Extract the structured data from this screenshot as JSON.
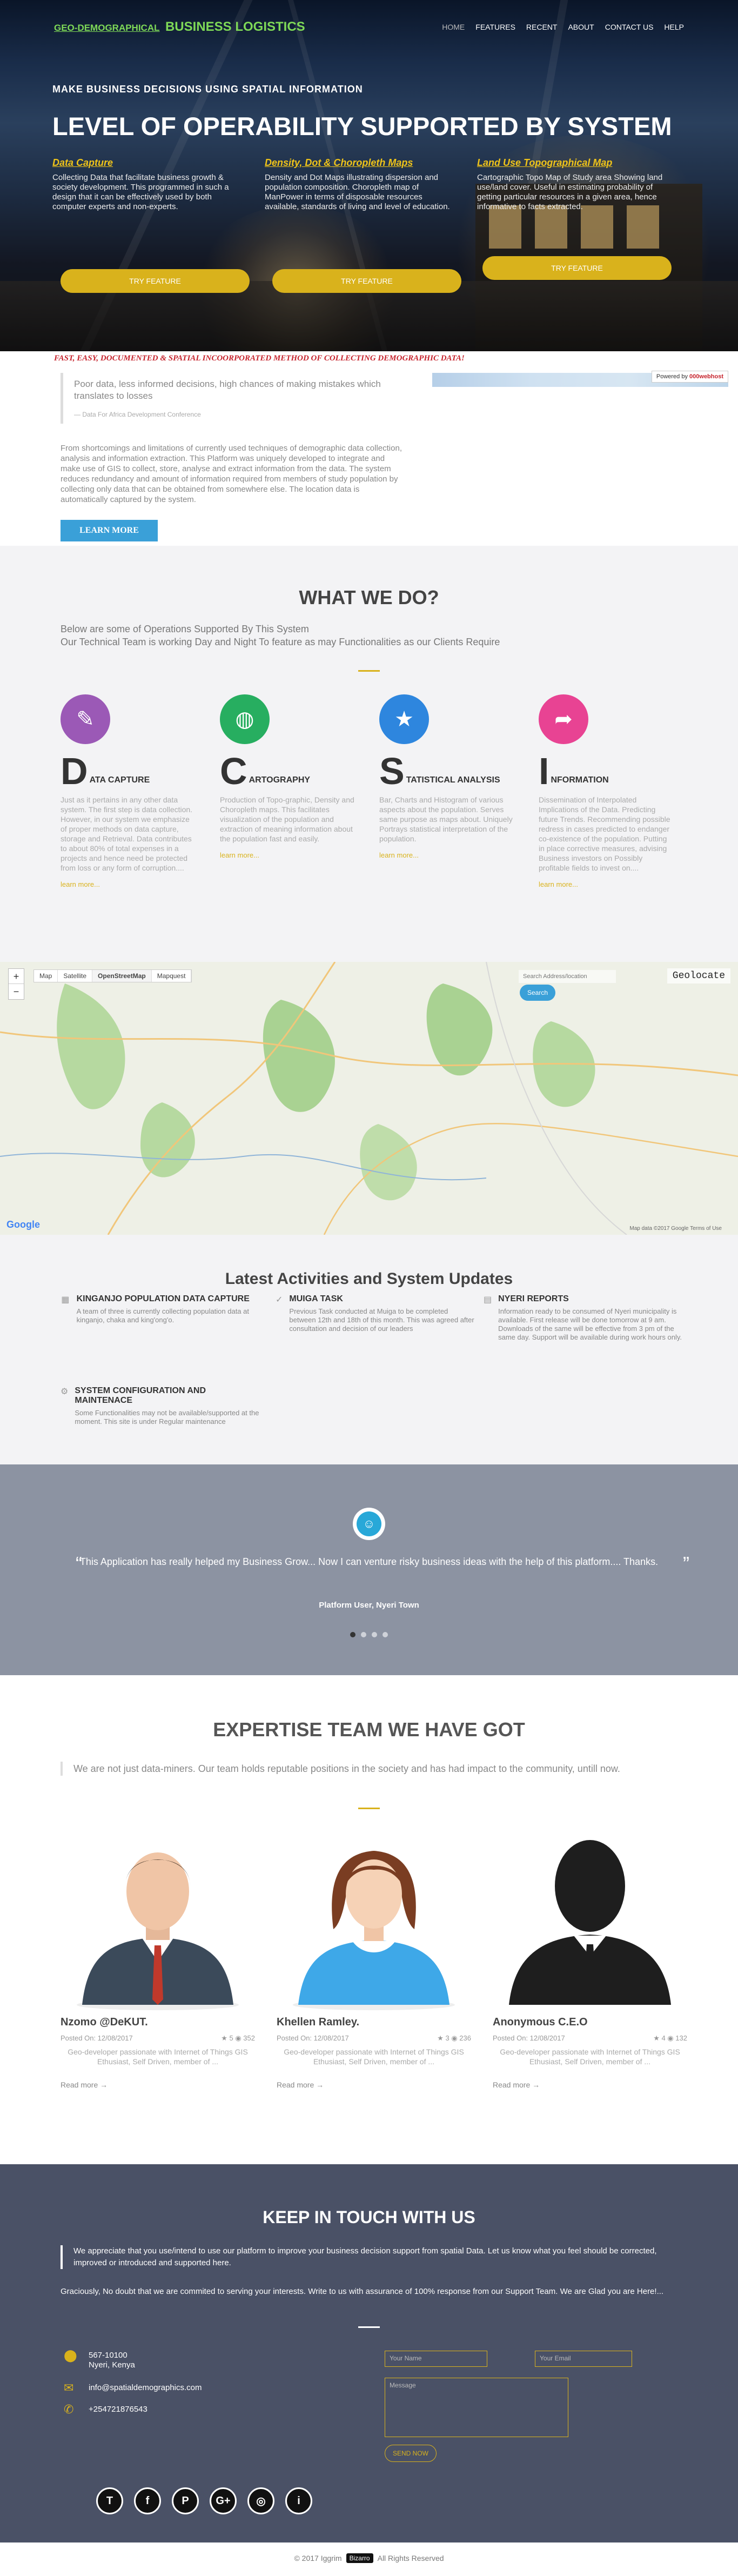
{
  "brand": {
    "geo": "GEO-DEMOGRAPHICAL",
    "logistics": "BUSINESS LOGISTICS"
  },
  "nav": [
    "HOME",
    "FEATURES",
    "RECENT",
    "ABOUT",
    "CONTACT US",
    "HELP"
  ],
  "hero": {
    "kicker": "MAKE BUSINESS DECISIONS USING SPATIAL INFORMATION",
    "title": "LEVEL OF OPERABILITY SUPPORTED BY SYSTEM",
    "features": [
      {
        "title": "Data Capture",
        "desc": "Collecting Data that facilitate business growth & society development. This programmed in such a design that it can be effectively used by both computer experts and non-experts.",
        "button": "TRY FEATURE"
      },
      {
        "title": "Density, Dot & Choropleth Maps",
        "desc": "Density and Dot Maps illustrating dispersion and population composition. Choropleth map of ManPower in terms of disposable resources available, standards of living and level of education.",
        "button": "TRY FEATURE"
      },
      {
        "title": "Land Use Topographical Map",
        "desc": "Cartographic Topo Map of Study area Showing land use/land cover. Useful in estimating probability of getting particular resources in a given area, hence informative to facts extracted.",
        "button": "TRY FEATURE"
      }
    ]
  },
  "intro": {
    "title": "FAST, EASY, DOCUMENTED & SPATIAL INCOORPORATED METHOD OF COLLECTING DEMOGRAPHIC DATA!",
    "quote": "Poor data, less informed decisions, high chances of making mistakes which translates to losses",
    "cite": "— Data For Africa Development Conference",
    "powered_prefix": "Powered by",
    "powered_brand": "000webhost",
    "body": "From shortcomings and limitations of currently used techniques of demographic data collection, analysis and information extraction. This Platform was uniquely developed to integrate and make use of GIS to collect, store, analyse and extract information from the data. The system reduces redundancy and amount of information required from members of study population by collecting only data that can be obtained from somewhere else. The location data is automatically captured by the system.",
    "button": "LEARN MORE"
  },
  "wwd": {
    "title": "WHAT WE DO?",
    "sub1": "Below are some of Operations Supported By This System",
    "sub2": "Our Technical Team is working Day and Night To feature as may Functionalities as our Clients Require",
    "services": [
      {
        "initial": "D",
        "rest": "ATA CAPTURE",
        "icon": "edit-icon",
        "color": "#9b59b6",
        "glyph": "✎",
        "desc": "Just as it pertains in any other data system. The first step is data collection. However, in our system we emphasize of proper methods on data capture, storage and Retrieval. Data contributes to about 80% of total expenses in a projects and hence need be protected from loss or any form of corruption....",
        "more": "learn more..."
      },
      {
        "initial": "C",
        "rest": "ARTOGRAPHY",
        "icon": "globe-icon",
        "color": "#27ae60",
        "glyph": "◍",
        "desc": "Production of Topo-graphic, Density and Choropleth maps. This facilitates visualization of the population and extraction of meaning information about the population fast and easily.",
        "more": "learn more..."
      },
      {
        "initial": "S",
        "rest": "TATISTICAL ANALYSIS",
        "icon": "star-icon",
        "color": "#2e86de",
        "glyph": "★",
        "desc": "Bar, Charts and Histogram of various aspects about the population. Serves same purpose as maps about. Uniquely Portrays statistical interpretation of the population.",
        "more": "learn more..."
      },
      {
        "initial": "I",
        "rest": "NFORMATION",
        "icon": "share-icon",
        "color": "#e84393",
        "glyph": "➦",
        "desc": "Dissemination of Interpolated Implications of the Data. Predicting future Trends. Recommending possible redress in cases predicted to endanger co-existence of the population. Putting in place corrective measures, advising Business investors on Possibly profitable fields to invest on....",
        "more": "learn more..."
      }
    ]
  },
  "map": {
    "tabs": [
      "Map",
      "Satellite",
      "OpenStreetMap",
      "Mapquest"
    ],
    "active_tab": "OpenStreetMap",
    "geolocate": "Geolocate",
    "search_placeholder": "Search Address/location",
    "search_button": "Search",
    "google": "Google",
    "credit": "Map data ©2017 Google   Terms of Use"
  },
  "latest": {
    "title": "Latest Activities and System Updates",
    "items": [
      {
        "icon": "calendar-icon",
        "glyph": "▦",
        "title": "KINGANJO POPULATION DATA CAPTURE",
        "desc": "A team of three is currently collecting population data at kinganjo, chaka and king'ong'o."
      },
      {
        "icon": "check-icon",
        "glyph": "✓",
        "title": "MUIGA TASK",
        "desc": "Previous Task conducted at Muiga to be completed between 12th and 18th of this month. This was agreed after consultation and decision of our leaders"
      },
      {
        "icon": "database-icon",
        "glyph": "▤",
        "title": "NYERI REPORTS",
        "desc": "Information ready to be consumed of Nyeri municipality is available. First release will be done tomorrow at 9 am. Downloads of the same will be effective from 3 pm of the same day. Support will be available during work hours only."
      },
      {
        "icon": "gear-icon",
        "glyph": "⚙",
        "title": "SYSTEM CONFIGURATION AND MAINTENACE",
        "desc": "Some Functionalities may not be available/supported at the moment. This site is under Regular maintenance"
      }
    ]
  },
  "testimonial": {
    "quote": "This Application has really helped my Business Grow... Now I can venture risky business ideas with the help of this platform.... Thanks.",
    "author": "Platform User, Nyeri Town",
    "slides": 4,
    "active": 0
  },
  "team": {
    "title": "EXPERTISE TEAM WE HAVE GOT",
    "sub": "We are not just data-miners. Our team holds reputable positions in the society and has had impact to the community, untill now.",
    "members": [
      {
        "name": "Nzomo @DeKUT.",
        "posted": "Posted On: 12/08/2017",
        "likes": "5",
        "views": "352",
        "desc": "Geo-developer passionate with Internet of Things GIS Ethusiast, Self Driven, member of ...",
        "more": "Read more →"
      },
      {
        "name": "Khellen Ramley.",
        "posted": "Posted On: 12/08/2017",
        "likes": "3",
        "views": "236",
        "desc": "Geo-developer passionate with Internet of Things GIS Ethusiast, Self Driven, member of ...",
        "more": "Read more →"
      },
      {
        "name": "Anonymous C.E.O",
        "posted": "Posted On: 12/08/2017",
        "likes": "4",
        "views": "132",
        "desc": "Geo-developer passionate with Internet of Things GIS Ethusiast, Self Driven, member of ...",
        "more": "Read more →"
      }
    ]
  },
  "contact": {
    "title": "KEEP IN TOUCH WITH US",
    "quote": "We appreciate that you use/intend to use our platform to improve your business decision support from spatial Data. Let us know what you feel should be corrected, improved or introduced and supported here.",
    "para": "Graciously, No doubt that we are commited to serving your interests. Write to us with assurance of 100% response from our Support Team. We are Glad you are Here!...",
    "address1": "567-10100",
    "address2": "Nyeri, Kenya",
    "email": "info@spatialdemographics.com",
    "phone": "+254721876543",
    "name_placeholder": "Your Name",
    "email_placeholder": "Your Email",
    "message_placeholder": "Message",
    "send": "SEND NOW",
    "social": [
      "T",
      "f",
      "P",
      "G+",
      "◎",
      "i"
    ]
  },
  "footer": {
    "copy": "© 2017 Iggrim",
    "badge": "Bizarro",
    "rights": "All Rights Reserved"
  }
}
